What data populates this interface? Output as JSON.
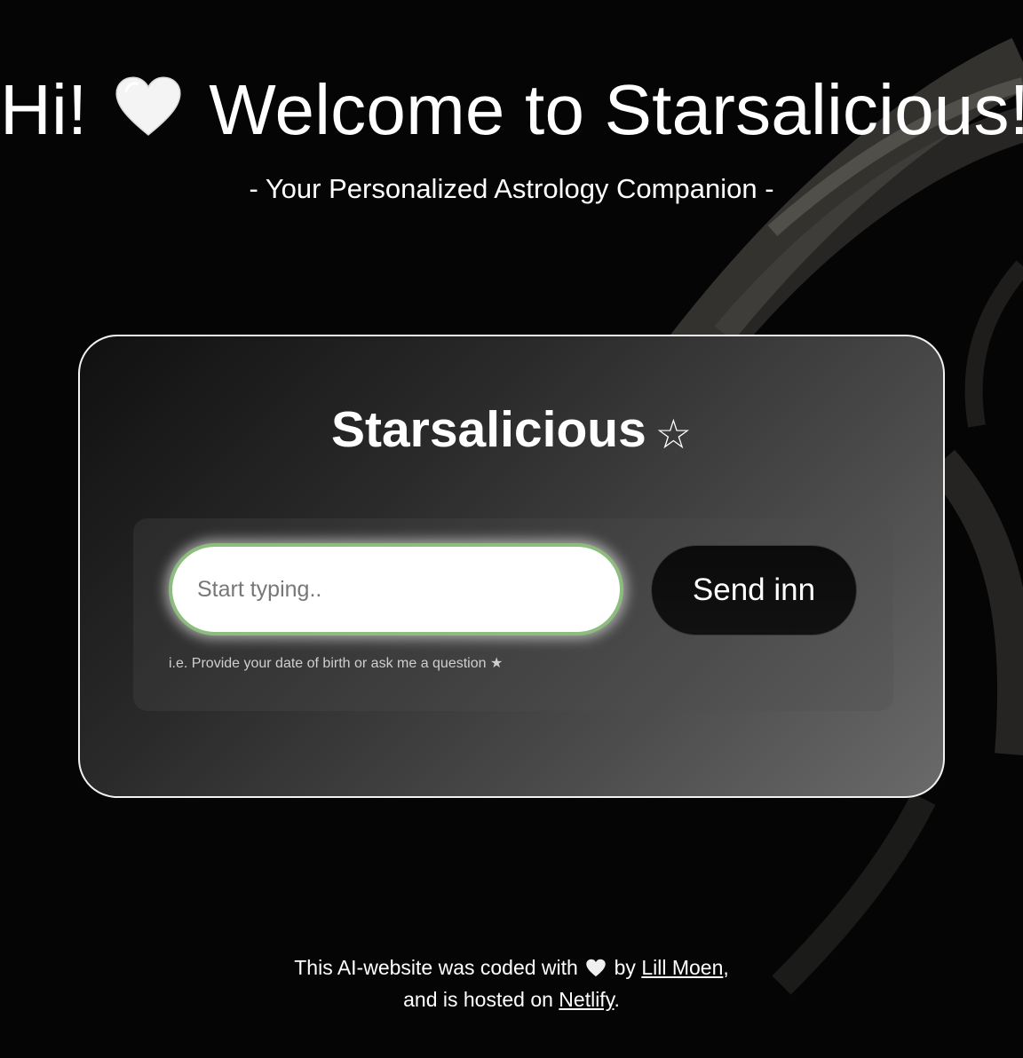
{
  "hero": {
    "title_before": "Hi!",
    "title_after": "Welcome to Starsalicious!",
    "subtitle": "- Your Personalized Astrology Companion -",
    "heart_icon": "white-heart-icon"
  },
  "card": {
    "title": "Starsalicious",
    "title_icon_glyph": "☆",
    "title_icon": "star-outline-icon",
    "input_placeholder": "Start typing..",
    "input_value": "",
    "send_label": "Send inn",
    "hint": "i.e. Provide your date of birth or ask me a question ★"
  },
  "footer": {
    "line1_before": "This AI-website was coded with",
    "line1_by": "by",
    "author_link": "Lill Moen",
    "line1_after": ",",
    "line2_before": "and is hosted on",
    "host_link": "Netlify",
    "line2_after": "."
  },
  "colors": {
    "background": "#050505",
    "input_border": "#8dbd7c",
    "card_border": "#f2f2f2"
  }
}
